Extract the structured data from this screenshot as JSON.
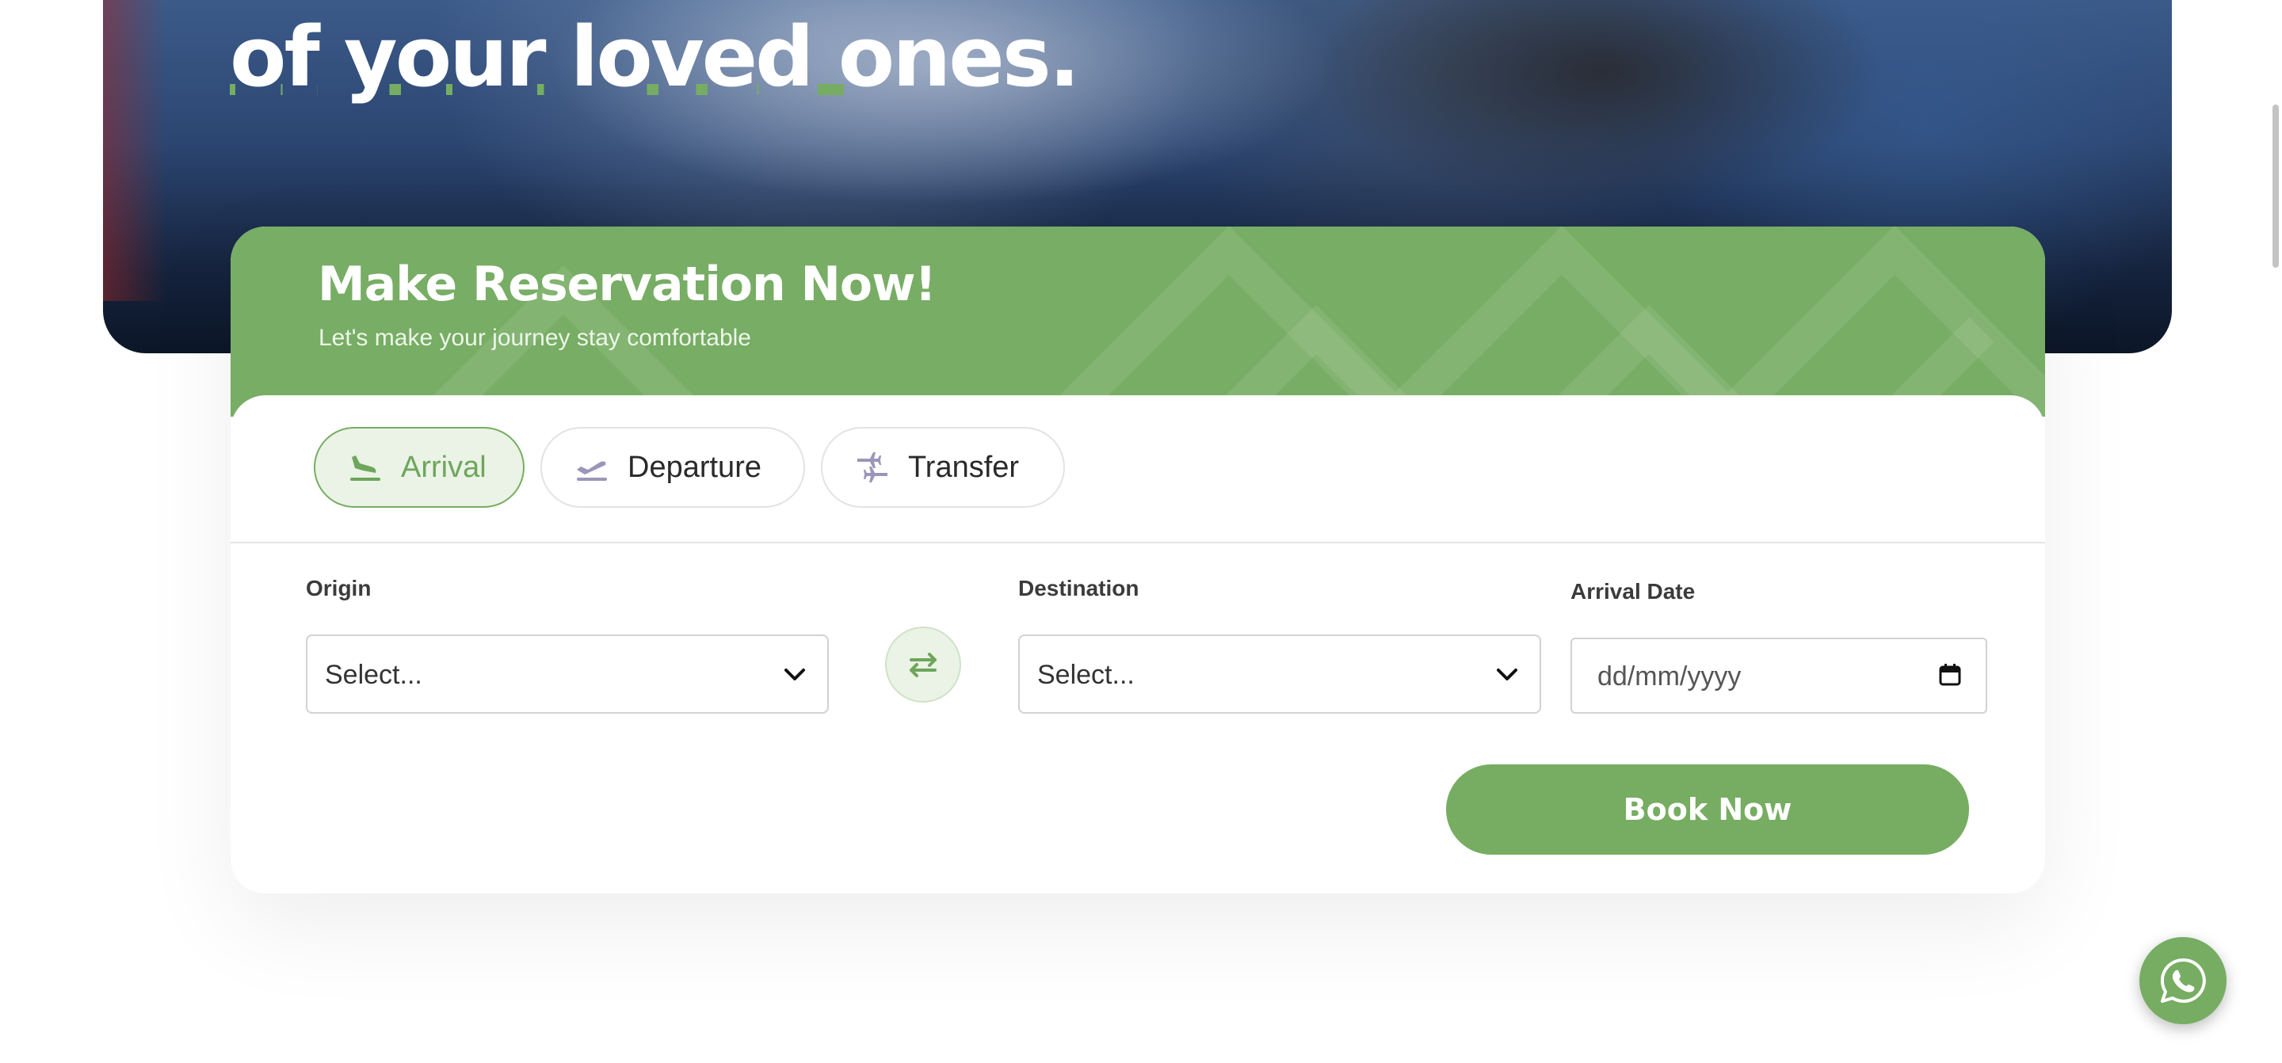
{
  "hero": {
    "title_part1": "of",
    "title_part2": "your",
    "title_part3": "loved ones",
    "title_period": "."
  },
  "reservation": {
    "title": "Make Reservation Now!",
    "subtitle": "Let's make your journey stay comfortable",
    "tabs": [
      {
        "label": "Arrival",
        "icon": "plane-landing-icon",
        "active": true
      },
      {
        "label": "Departure",
        "icon": "plane-takeoff-icon",
        "active": false
      },
      {
        "label": "Transfer",
        "icon": "plane-transfer-icon",
        "active": false
      }
    ],
    "origin": {
      "label": "Origin",
      "value": "Select..."
    },
    "destination": {
      "label": "Destination",
      "value": "Select..."
    },
    "arrival_date": {
      "label": "Arrival Date",
      "placeholder": "dd/mm/yyyy"
    },
    "book_label": "Book Now"
  },
  "colors": {
    "brand_green": "#76ad62",
    "active_tab_bg": "#eaf3e6",
    "icon_muted": "#9b96b8"
  }
}
